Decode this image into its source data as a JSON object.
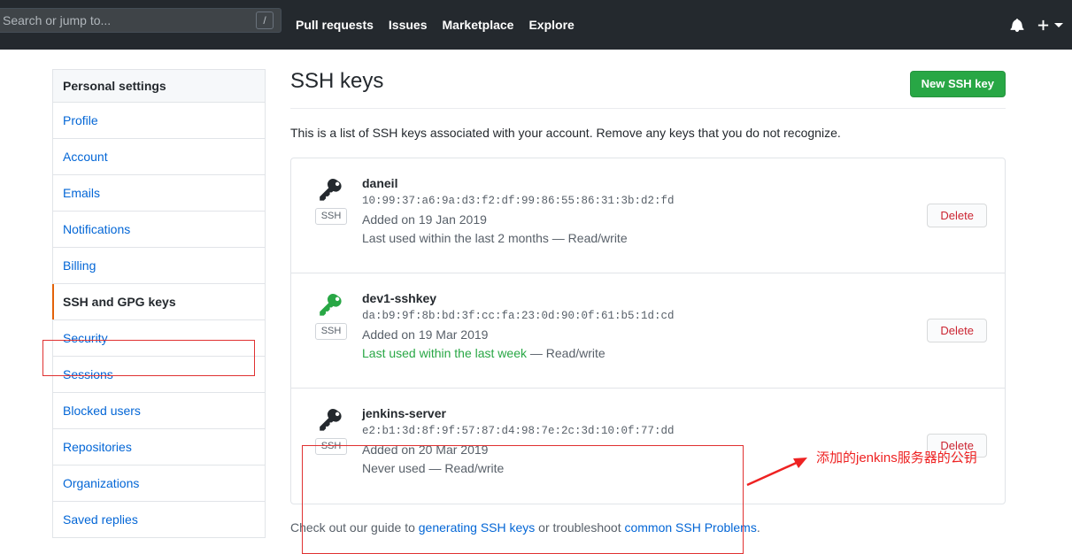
{
  "header": {
    "search": {
      "placeholder": "Search or jump to...",
      "value": "",
      "shortcut_badge": "/"
    },
    "nav": [
      {
        "label": "Pull requests"
      },
      {
        "label": "Issues"
      },
      {
        "label": "Marketplace"
      },
      {
        "label": "Explore"
      }
    ],
    "icons": {
      "notifications": "bell-icon",
      "create_new": "plus-icon",
      "create_new_caret": "chevron-down-icon"
    },
    "background_color": "#24292e"
  },
  "sidebar": {
    "heading": "Personal settings",
    "items": [
      {
        "label": "Profile",
        "selected": false
      },
      {
        "label": "Account",
        "selected": false
      },
      {
        "label": "Emails",
        "selected": false
      },
      {
        "label": "Notifications",
        "selected": false
      },
      {
        "label": "Billing",
        "selected": false
      },
      {
        "label": "SSH and GPG keys",
        "selected": true
      },
      {
        "label": "Security",
        "selected": false
      },
      {
        "label": "Sessions",
        "selected": false
      },
      {
        "label": "Blocked users",
        "selected": false
      },
      {
        "label": "Repositories",
        "selected": false
      },
      {
        "label": "Organizations",
        "selected": false
      },
      {
        "label": "Saved replies",
        "selected": false
      }
    ],
    "selected_accent_color": "#e36209",
    "link_color": "#0366d6"
  },
  "main": {
    "title": "SSH keys",
    "new_key_button": "New SSH key",
    "new_key_button_color": "#28a745",
    "intro": "This is a list of SSH keys associated with your account. Remove any keys that you do not recognize.",
    "keys": [
      {
        "name": "daneil",
        "fingerprint": "10:99:37:a6:9a:d3:f2:df:99:86:55:86:31:3b:d2:fd",
        "added": "Added on 19 Jan 2019",
        "usage": "Last used within the last 2 months",
        "usage_separator": " — Read/write",
        "usage_is_recent": false,
        "badge": "SSH",
        "key_icon_color": "#24292e",
        "delete_label": "Delete"
      },
      {
        "name": "dev1-sshkey",
        "fingerprint": "da:b9:9f:8b:bd:3f:cc:fa:23:0d:90:0f:61:b5:1d:cd",
        "added": "Added on 19 Mar 2019",
        "usage": "Last used within the last week",
        "usage_separator": " — Read/write",
        "usage_is_recent": true,
        "badge": "SSH",
        "key_icon_color": "#28a745",
        "delete_label": "Delete"
      },
      {
        "name": "jenkins-server",
        "fingerprint": "e2:b1:3d:8f:9f:57:87:d4:98:7e:2c:3d:10:0f:77:dd",
        "added": "Added on 20 Mar 2019",
        "usage": "Never used",
        "usage_separator": " — Read/write",
        "usage_is_recent": false,
        "badge": "SSH",
        "key_icon_color": "#24292e",
        "delete_label": "Delete"
      }
    ],
    "footnote": {
      "prefix": "Check out our guide to ",
      "link1": "generating SSH keys",
      "middle": " or troubleshoot ",
      "link2": "common SSH Problems",
      "suffix": "."
    }
  },
  "annotations": {
    "color": "#ee2222",
    "sidebar_highlight_target": "SSH and GPG keys",
    "key_highlight_target": "jenkins-server",
    "note_text": "添加的jenkins服务器的公钥"
  }
}
